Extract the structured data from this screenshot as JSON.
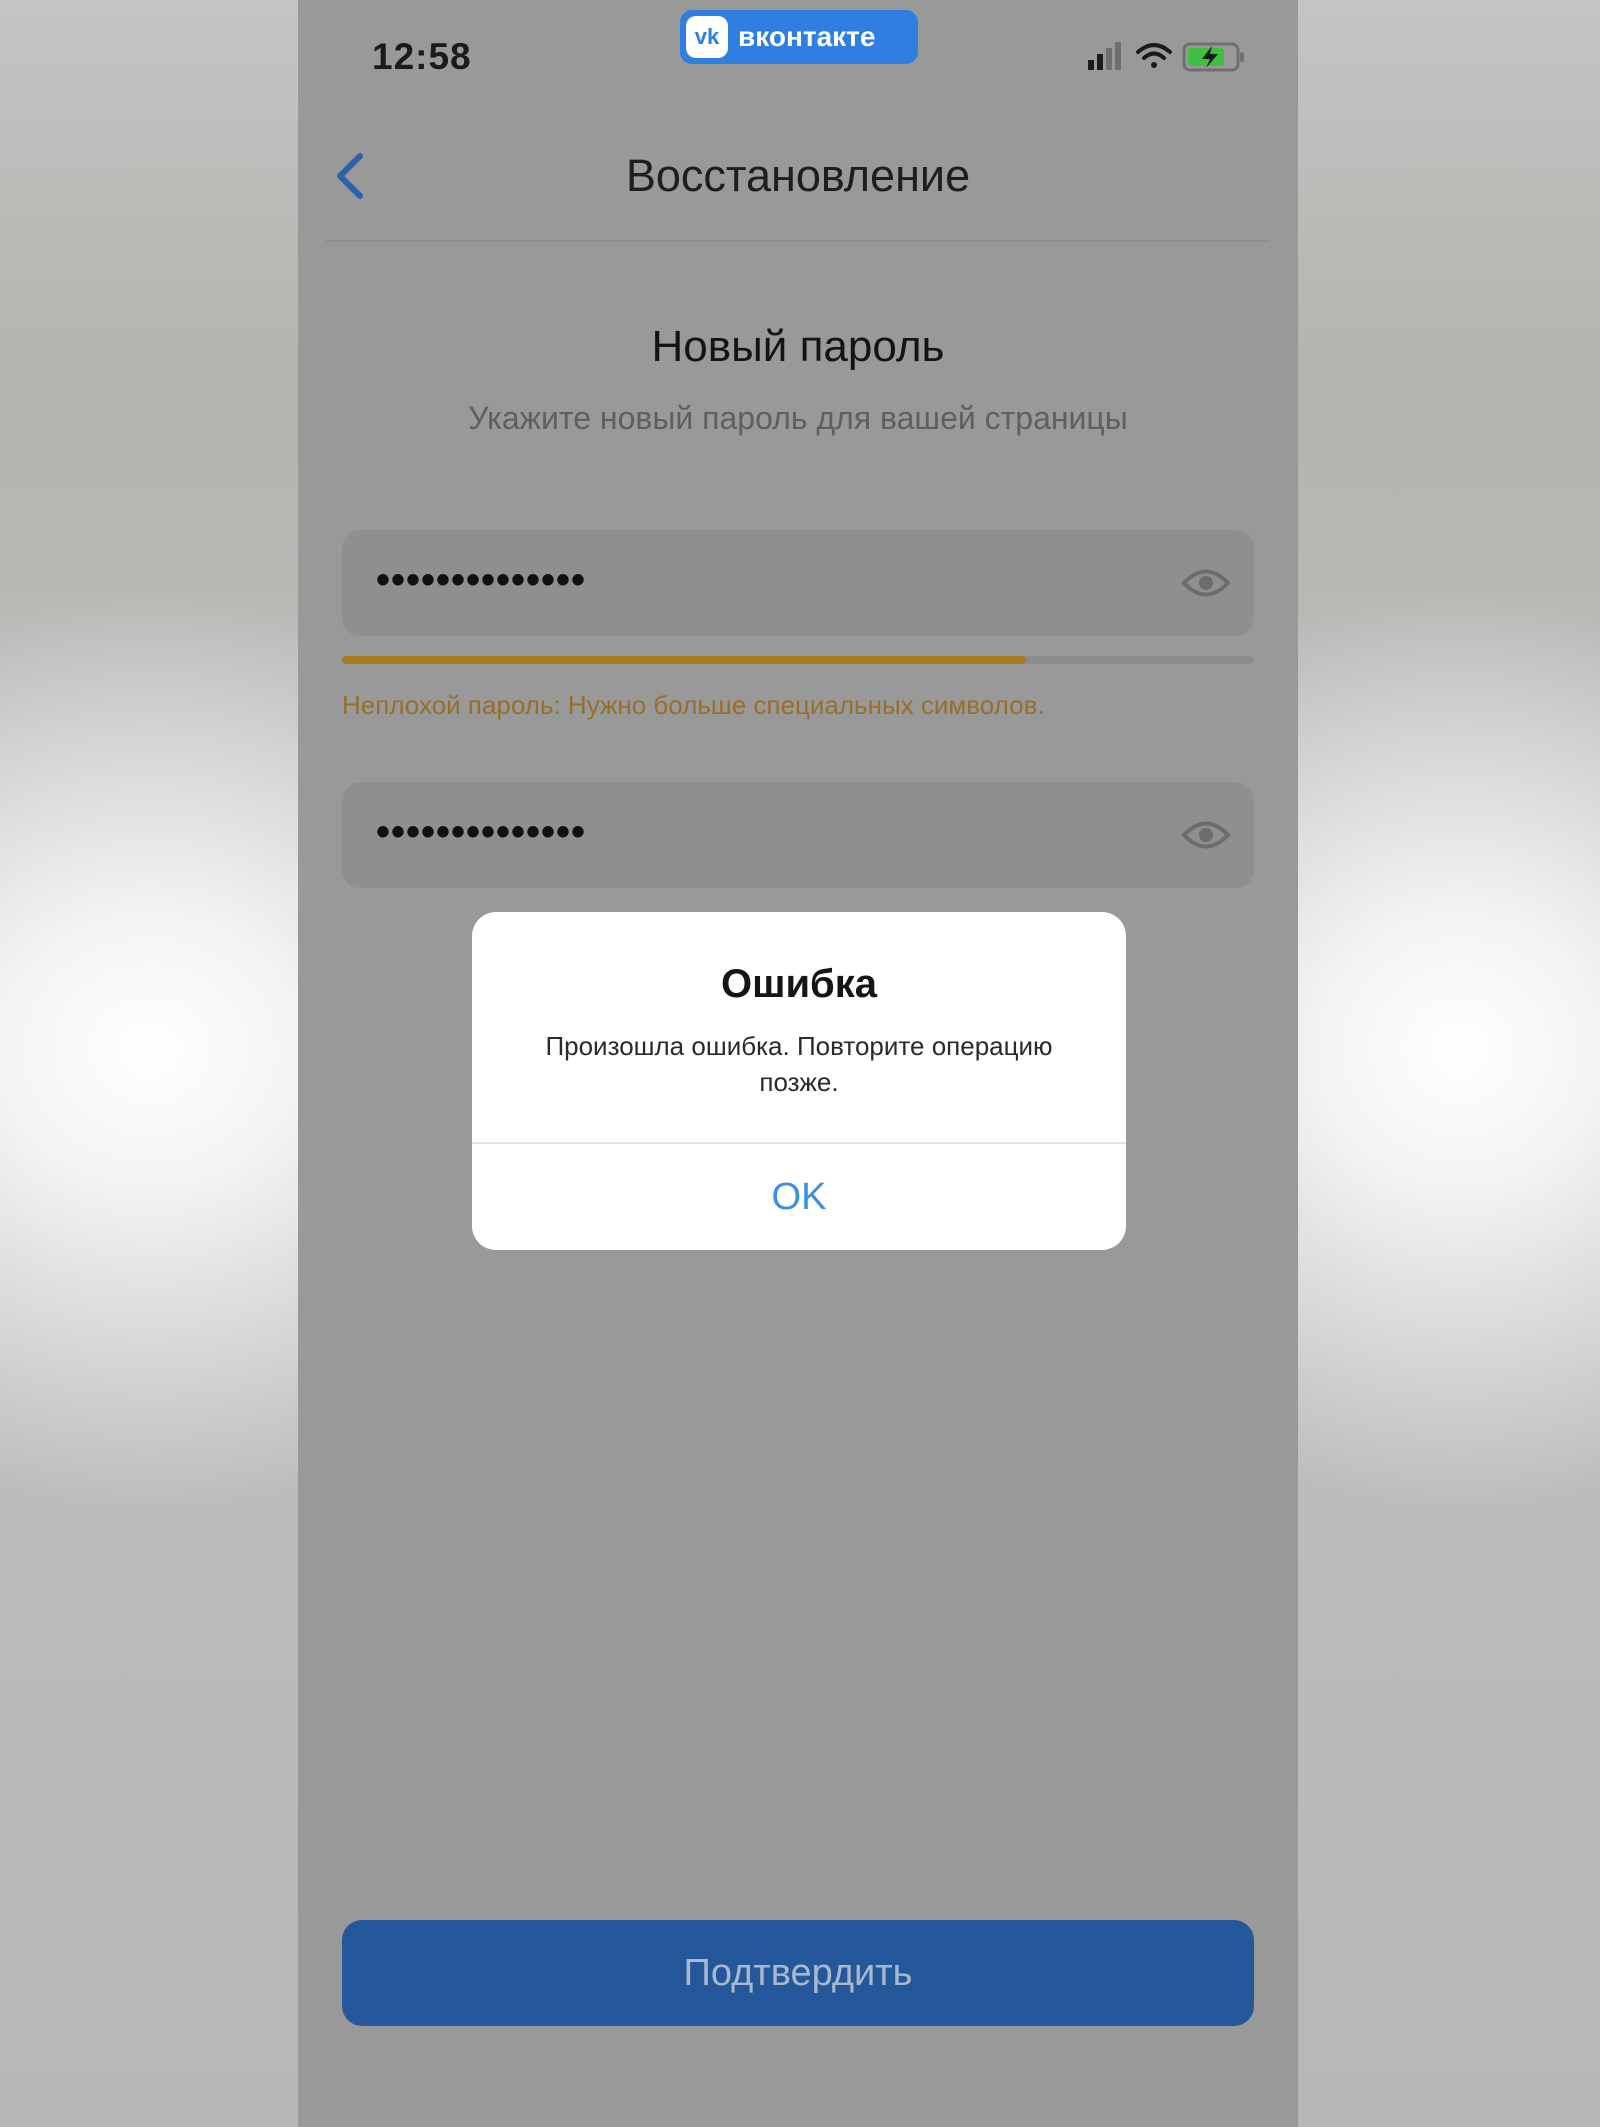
{
  "status_bar": {
    "time": "12:58",
    "app_badge": "вконтакте",
    "app_logo_text": "vk",
    "icons": [
      "signal-icon",
      "wifi-icon",
      "battery-charging-icon"
    ]
  },
  "nav": {
    "title": "Восстановление",
    "back_icon": "chevron-left-icon"
  },
  "form": {
    "heading": "Новый пароль",
    "subheading": "Укажите новый пароль для вашей страницы",
    "password_value": "••••••••••••••",
    "confirm_value": "••••••••••••••",
    "strength_fraction": 0.75,
    "strength_hint": "Неплохой пароль: Нужно больше специальных символов.",
    "eye_icon": "eye-icon"
  },
  "alert": {
    "title": "Ошибка",
    "message": "Произошла ошибка. Повторите операцию позже.",
    "ok_label": "OK"
  },
  "footer": {
    "confirm_label": "Подтвердить"
  },
  "colors": {
    "accent": "#2f7fe0",
    "strength": "#a87a1b",
    "button": "#25589a",
    "ok": "#3b8fe8"
  }
}
